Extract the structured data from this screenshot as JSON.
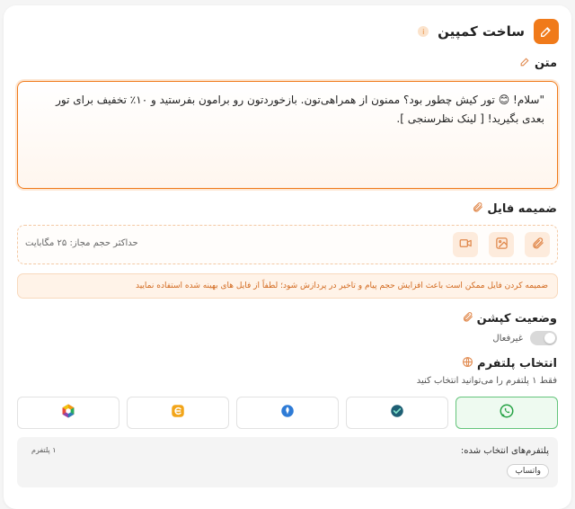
{
  "header": {
    "title": "ساخت کمپین",
    "info_symbol": "i"
  },
  "message": {
    "label": "متن",
    "text": "\"سلام! 😊 تور کیش چطور بود؟ ممنون از همراهی‌تون. بازخوردتون رو برامون بفرستید و ۱۰٪ تخفیف برای تور بعدی بگیرید! [ لینک نظرسنجی ]."
  },
  "attachment": {
    "label": "ضمیمه فایل",
    "max_size": "حداکثر حجم مجاز: ۲۵ مگابایت",
    "buttons": [
      "attachment-icon",
      "image-icon",
      "video-icon"
    ],
    "warning": "ضمیمه کردن فایل ممکن است باعث افزایش حجم پیام و تاخیر در پردازش شود؛ لطفاً از فایل های بهینه شده استفاده نمایید"
  },
  "caption": {
    "label": "وضعیت کپشن",
    "status": "غیرفعال",
    "enabled": false
  },
  "platform": {
    "label": "انتخاب پلتفرم",
    "hint": "فقط ۱ پلتفرم را می‌توانید انتخاب کنید",
    "options": [
      {
        "icon": "whatsapp-icon",
        "selected": true,
        "color": "#25a244"
      },
      {
        "icon": "bale-icon",
        "selected": false,
        "color": "#1e5f74"
      },
      {
        "icon": "soroush-icon",
        "selected": false,
        "color": "#2e7bd6"
      },
      {
        "icon": "eitaa-icon",
        "selected": false,
        "color": "#f2a51a"
      },
      {
        "icon": "rubika-icon",
        "selected": false,
        "color": "#e84c3d"
      }
    ],
    "selected_title": "پلتفرم‌های انتخاب شده:",
    "selected_count": "۱ پلتفرم",
    "selected_chip": "واتساپ"
  },
  "colors": {
    "accent": "#f07a1a",
    "success": "#64c47b"
  }
}
